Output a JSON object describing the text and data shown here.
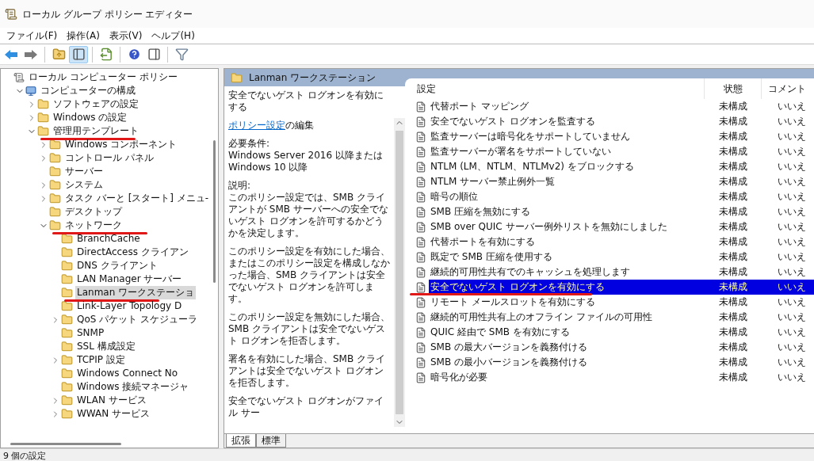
{
  "window": {
    "title": "ローカル グループ ポリシー エディター"
  },
  "menu": [
    "ファイル(F)",
    "操作(A)",
    "表示(V)",
    "ヘルプ(H)"
  ],
  "toolbar": [
    {
      "kind": "back",
      "pressed": false
    },
    {
      "kind": "forward",
      "pressed": false
    },
    {
      "kind": "sep"
    },
    {
      "kind": "up",
      "pressed": false
    },
    {
      "kind": "pane",
      "pressed": true
    },
    {
      "kind": "sep"
    },
    {
      "kind": "export",
      "pressed": false
    },
    {
      "kind": "sep"
    },
    {
      "kind": "help",
      "pressed": false
    },
    {
      "kind": "props",
      "pressed": false
    },
    {
      "kind": "sep"
    },
    {
      "kind": "filter",
      "pressed": false
    }
  ],
  "tree": [
    {
      "label": "ローカル コンピューター ポリシー",
      "kind": "policy",
      "children": [
        {
          "label": "コンピューターの構成",
          "kind": "computer",
          "expanded": true,
          "children": [
            {
              "label": "ソフトウェアの設定",
              "kind": "folder",
              "expanded": false
            },
            {
              "label": "Windows の設定",
              "kind": "folder",
              "expanded": false
            },
            {
              "label": "管理用テンプレート",
              "kind": "folder",
              "expanded": true,
              "annotated": true,
              "children": [
                {
                  "label": "Windows コンポーネント",
                  "kind": "folder",
                  "expanded": false
                },
                {
                  "label": "コントロール パネル",
                  "kind": "folder",
                  "expanded": false
                },
                {
                  "label": "サーバー",
                  "kind": "folder"
                },
                {
                  "label": "システム",
                  "kind": "folder",
                  "expanded": false
                },
                {
                  "label": "タスク バーと [スタート] メニュ-",
                  "kind": "folder",
                  "expanded": false
                },
                {
                  "label": "デスクトップ",
                  "kind": "folder"
                },
                {
                  "label": "ネットワーク",
                  "kind": "folder",
                  "expanded": true,
                  "annotated": true,
                  "children": [
                    {
                      "label": "BranchCache",
                      "kind": "folder",
                      "selected": false
                    },
                    {
                      "label": "DirectAccess クライアン",
                      "kind": "folder",
                      "selected": false
                    },
                    {
                      "label": "DNS クライアント",
                      "kind": "folder",
                      "selected": false
                    },
                    {
                      "label": "LAN Manager サーバー",
                      "kind": "folder",
                      "selected": false
                    },
                    {
                      "label": "Lanman ワークステーショ",
                      "kind": "folder",
                      "selected": true,
                      "annotated": true
                    },
                    {
                      "label": "Link-Layer Topology D",
                      "kind": "folder",
                      "selected": false
                    },
                    {
                      "label": "QoS パケット スケジューラ",
                      "kind": "folder",
                      "expanded": false,
                      "selected": false
                    },
                    {
                      "label": "SNMP",
                      "kind": "folder",
                      "selected": false
                    },
                    {
                      "label": "SSL 構成設定",
                      "kind": "folder",
                      "selected": false
                    },
                    {
                      "label": "TCPIP 設定",
                      "kind": "folder",
                      "expanded": false,
                      "selected": false
                    },
                    {
                      "label": "Windows Connect No",
                      "kind": "folder",
                      "selected": false
                    },
                    {
                      "label": "Windows 接続マネージャ",
                      "kind": "folder",
                      "selected": false
                    },
                    {
                      "label": "WLAN サービス",
                      "kind": "folder",
                      "expanded": false,
                      "selected": false
                    },
                    {
                      "label": "WWAN サービス",
                      "kind": "folder",
                      "expanded": false,
                      "selected": false
                    }
                  ]
                }
              ]
            }
          ]
        }
      ]
    }
  ],
  "pane_header": "Lanman ワークステーション",
  "description": {
    "title": "安全でないゲスト ログオンを有効にする",
    "link": "ポリシー設定",
    "link_suffix": "の編集",
    "paragraphs": [
      "必要条件:\nWindows Server 2016 以降または\nWindows 10 以降",
      "説明:\nこのポリシー設定では、SMB クライアントが SMB サーバーへの安全でないゲスト ログオンを許可するかどうかを決定します。",
      "このポリシー設定を有効にした場合、またはこのポリシー設定を構成しなかった場合、SMB クライアントは安全でないゲスト ログオンを許可します。",
      "このポリシー設定を無効にした場合、SMB クライアントは安全でないゲスト ログオンを拒否します。",
      "署名を有効にした場合、SMB クライアントは安全でないゲスト ログオンを拒否します。",
      "安全でないゲスト ログオンがファイル サー"
    ]
  },
  "columns": [
    "設定",
    "状態",
    "コメント"
  ],
  "rows": [
    {
      "name": "代替ポート マッピング",
      "state": "未構成",
      "comment": "いいえ",
      "selected": false
    },
    {
      "name": "安全でないゲスト ログオンを監査する",
      "state": "未構成",
      "comment": "いいえ",
      "selected": false
    },
    {
      "name": "監査サーバーは暗号化をサポートしていません",
      "state": "未構成",
      "comment": "いいえ",
      "selected": false
    },
    {
      "name": "監査サーバーが署名をサポートしていない",
      "state": "未構成",
      "comment": "いいえ",
      "selected": false
    },
    {
      "name": "NTLM (LM、NTLM、NTLMv2) をブロックする",
      "state": "未構成",
      "comment": "いいえ",
      "selected": false
    },
    {
      "name": "NTLM サーバー禁止例外一覧",
      "state": "未構成",
      "comment": "いいえ",
      "selected": false
    },
    {
      "name": "暗号の順位",
      "state": "未構成",
      "comment": "いいえ",
      "selected": false
    },
    {
      "name": "SMB 圧縮を無効にする",
      "state": "未構成",
      "comment": "いいえ",
      "selected": false
    },
    {
      "name": "SMB over QUIC サーバー例外リストを無効にしました",
      "state": "未構成",
      "comment": "いいえ",
      "selected": false
    },
    {
      "name": "代替ポートを有効にする",
      "state": "未構成",
      "comment": "いいえ",
      "selected": false
    },
    {
      "name": "既定で SMB 圧縮を使用する",
      "state": "未構成",
      "comment": "いいえ",
      "selected": false
    },
    {
      "name": "継続的可用性共有でのキャッシュを処理します",
      "state": "未構成",
      "comment": "いいえ",
      "selected": false
    },
    {
      "name": "安全でないゲスト ログオンを有効にする",
      "state": "未構成",
      "comment": "いいえ",
      "selected": true,
      "annotated": true
    },
    {
      "name": "リモート メールスロットを有効にする",
      "state": "未構成",
      "comment": "いいえ",
      "selected": false
    },
    {
      "name": "継続的可用性共有上のオフライン ファイルの可用性",
      "state": "未構成",
      "comment": "いいえ",
      "selected": false
    },
    {
      "name": "QUIC 経由で SMB を有効にする",
      "state": "未構成",
      "comment": "いいえ",
      "selected": false
    },
    {
      "name": "SMB の最大バージョンを義務付ける",
      "state": "未構成",
      "comment": "いいえ",
      "selected": false
    },
    {
      "name": "SMB の最小バージョンを義務付ける",
      "state": "未構成",
      "comment": "いいえ",
      "selected": false
    },
    {
      "name": "暗号化が必要",
      "state": "未構成",
      "comment": "いいえ",
      "selected": false
    }
  ],
  "view_tabs": [
    {
      "label": "拡張",
      "selected": true
    },
    {
      "label": "標準",
      "selected": false
    }
  ],
  "status_bar": "9 個の設定"
}
